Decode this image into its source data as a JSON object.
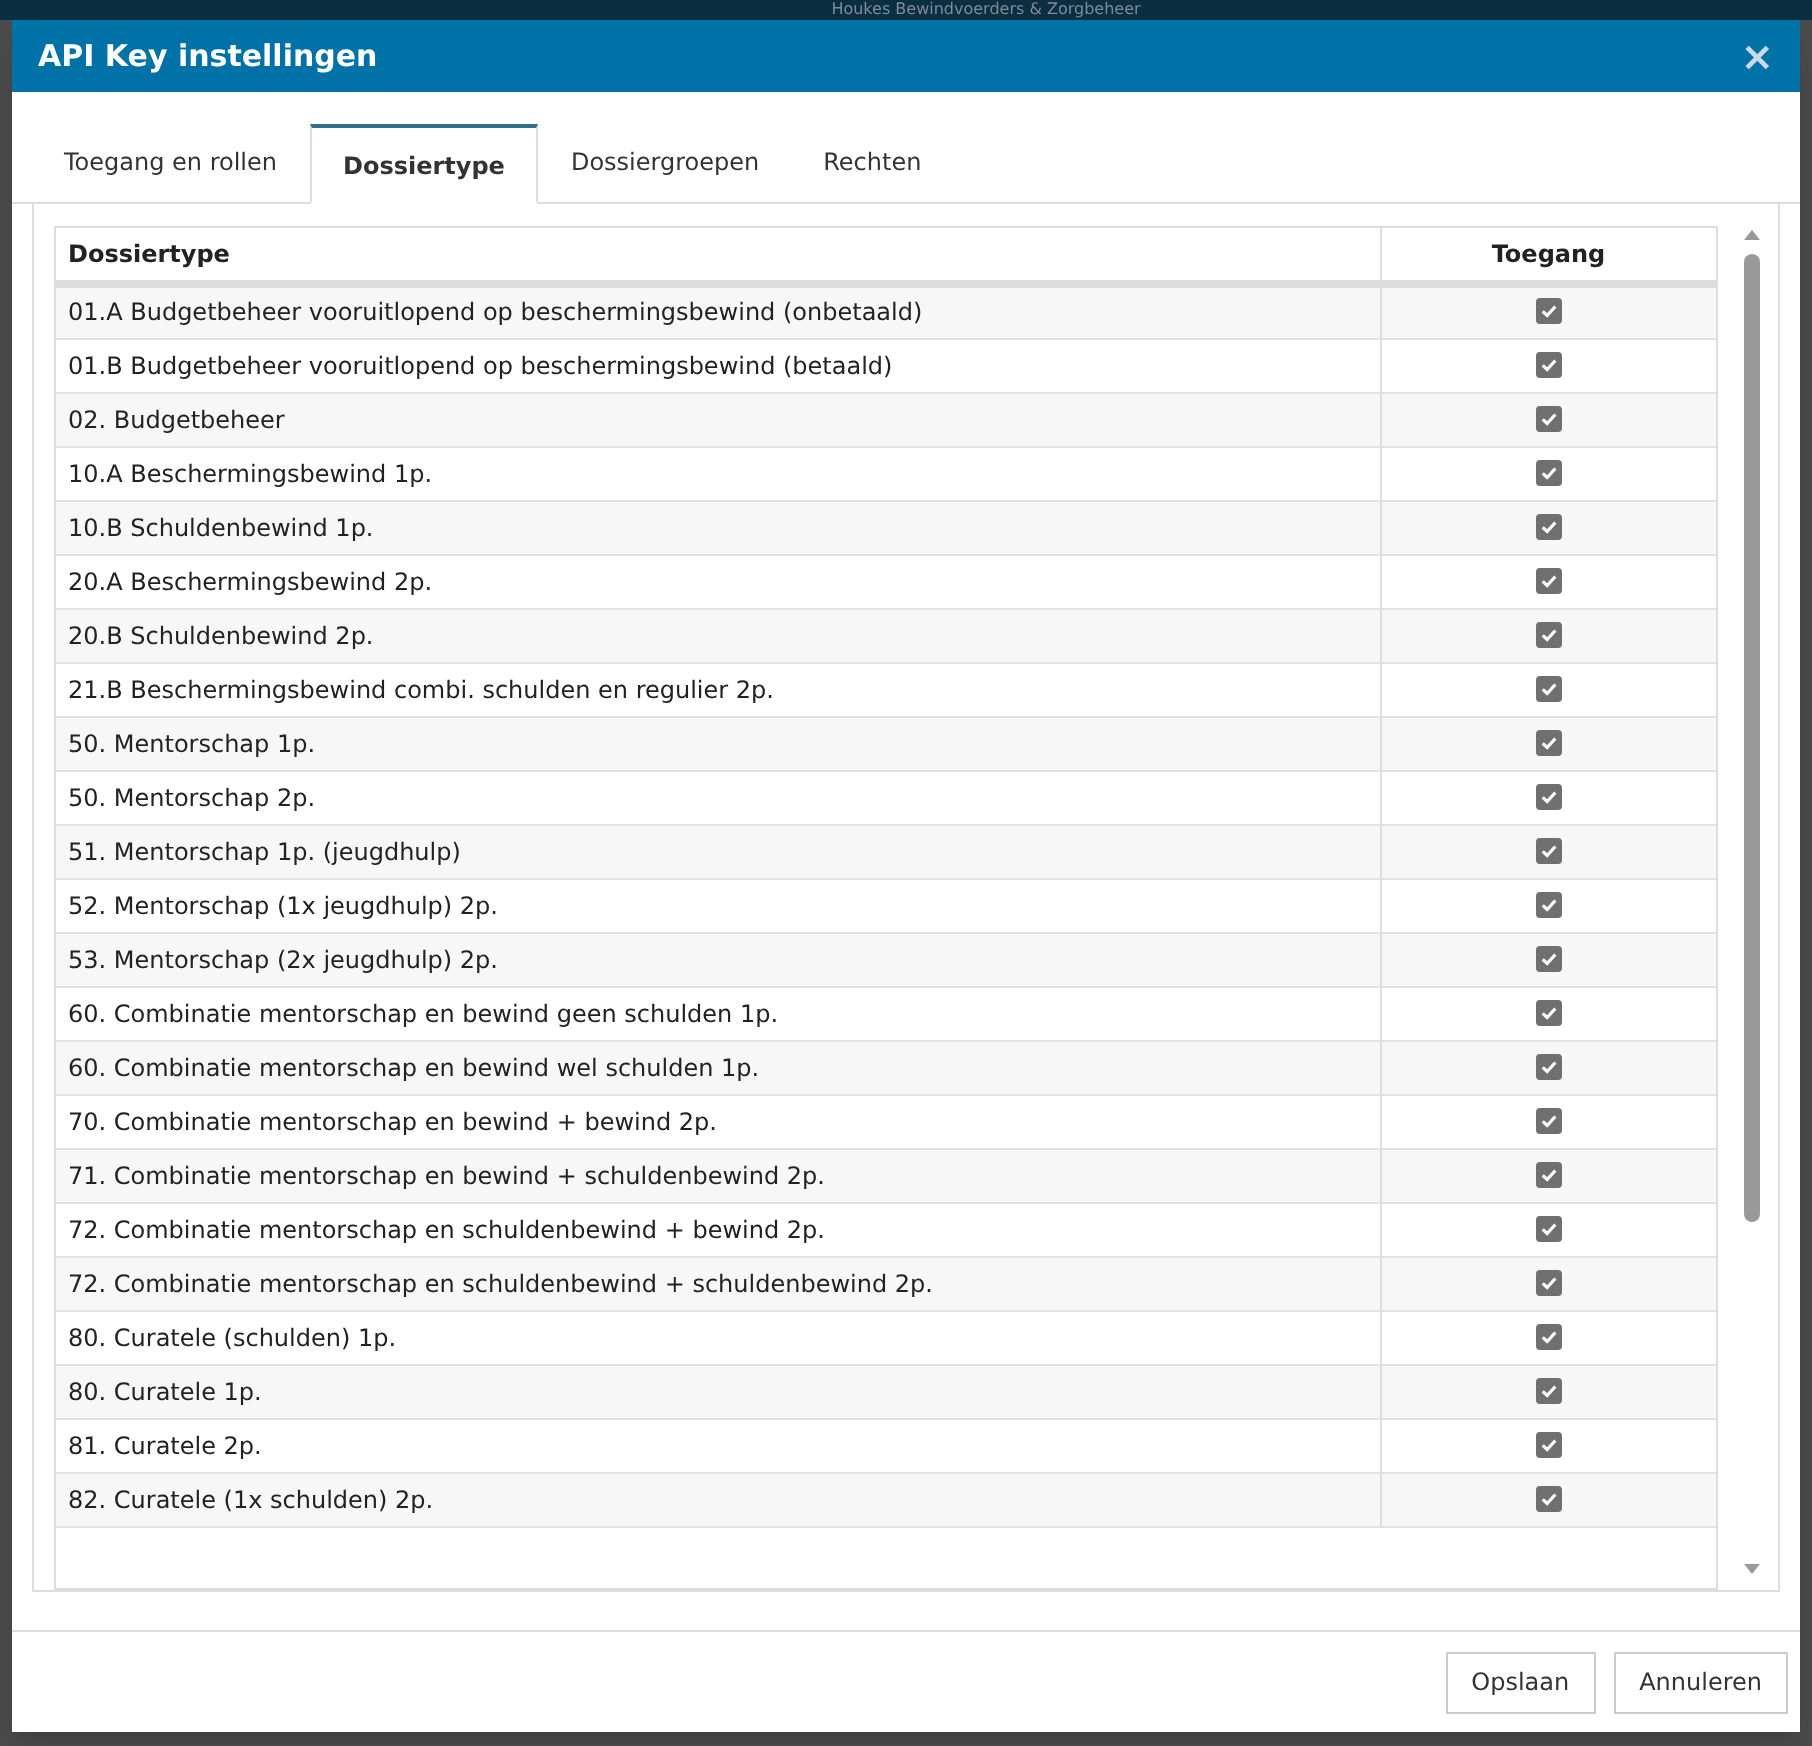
{
  "background": {
    "app_title": "Houkes Bewindvoerders & Zorgbeheer"
  },
  "dialog": {
    "title": "API Key instellingen",
    "close_label": "×"
  },
  "tabs": [
    {
      "label": "Toegang en rollen",
      "selected": false
    },
    {
      "label": "Dossiertype",
      "selected": true
    },
    {
      "label": "Dossiergroepen",
      "selected": false
    },
    {
      "label": "Rechten",
      "selected": false
    }
  ],
  "table": {
    "columns": [
      "Dossiertype",
      "Toegang"
    ],
    "rows": [
      {
        "name": "01.A Budgetbeheer vooruitlopend op beschermingsbewind (onbetaald)",
        "checked": true
      },
      {
        "name": "01.B Budgetbeheer vooruitlopend op beschermingsbewind (betaald)",
        "checked": true
      },
      {
        "name": "02. Budgetbeheer",
        "checked": true
      },
      {
        "name": "10.A Beschermingsbewind 1p.",
        "checked": true
      },
      {
        "name": "10.B Schuldenbewind 1p.",
        "checked": true
      },
      {
        "name": "20.A Beschermingsbewind 2p.",
        "checked": true
      },
      {
        "name": "20.B Schuldenbewind 2p.",
        "checked": true
      },
      {
        "name": "21.B Beschermingsbewind combi. schulden en regulier 2p.",
        "checked": true
      },
      {
        "name": "50. Mentorschap 1p.",
        "checked": true
      },
      {
        "name": "50. Mentorschap 2p.",
        "checked": true
      },
      {
        "name": "51. Mentorschap 1p. (jeugdhulp)",
        "checked": true
      },
      {
        "name": "52. Mentorschap (1x jeugdhulp) 2p.",
        "checked": true
      },
      {
        "name": "53. Mentorschap (2x jeugdhulp) 2p.",
        "checked": true
      },
      {
        "name": "60. Combinatie mentorschap en bewind geen schulden 1p.",
        "checked": true
      },
      {
        "name": "60. Combinatie mentorschap en bewind wel schulden 1p.",
        "checked": true
      },
      {
        "name": "70. Combinatie mentorschap en bewind + bewind 2p.",
        "checked": true
      },
      {
        "name": "71. Combinatie mentorschap en bewind + schuldenbewind 2p.",
        "checked": true
      },
      {
        "name": "72. Combinatie mentorschap en schuldenbewind + bewind 2p.",
        "checked": true
      },
      {
        "name": "72. Combinatie mentorschap en schuldenbewind + schuldenbewind 2p.",
        "checked": true
      },
      {
        "name": "80. Curatele (schulden) 1p.",
        "checked": true
      },
      {
        "name": "80. Curatele 1p.",
        "checked": true
      },
      {
        "name": "81. Curatele 2p.",
        "checked": true
      },
      {
        "name": "82. Curatele (1x schulden) 2p.",
        "checked": true
      }
    ]
  },
  "buttons": [
    "Opslaan",
    "Annuleren"
  ]
}
